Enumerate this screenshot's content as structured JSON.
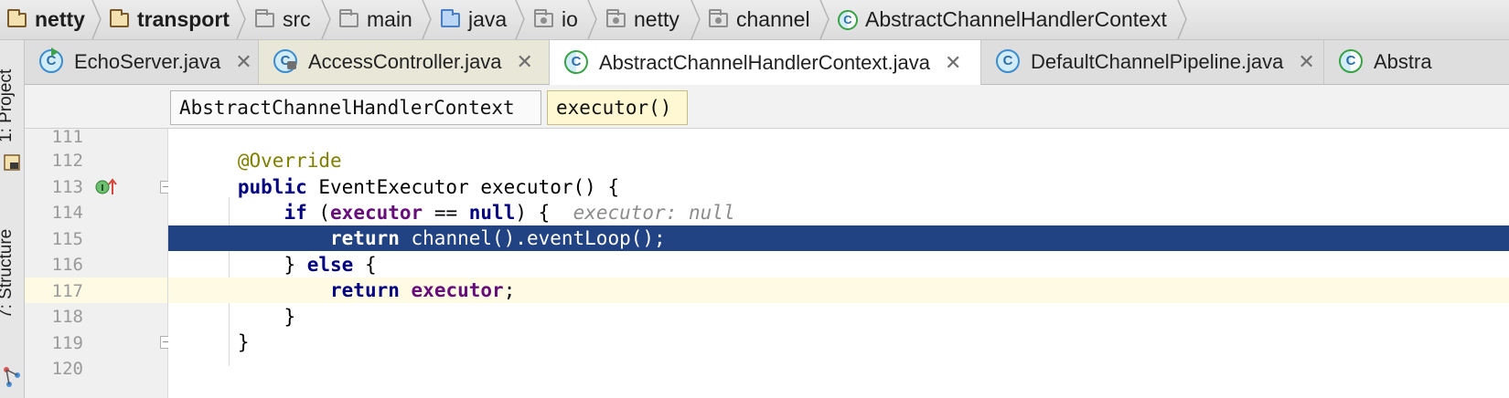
{
  "breadcrumbs": [
    {
      "label": "netty",
      "icon": "module-folder-icon",
      "bold": true
    },
    {
      "label": "transport",
      "icon": "module-folder-icon",
      "bold": true
    },
    {
      "label": "src",
      "icon": "folder-icon",
      "bold": false
    },
    {
      "label": "main",
      "icon": "folder-icon",
      "bold": false
    },
    {
      "label": "java",
      "icon": "source-folder-icon",
      "bold": false
    },
    {
      "label": "io",
      "icon": "package-icon",
      "bold": false
    },
    {
      "label": "netty",
      "icon": "package-icon",
      "bold": false
    },
    {
      "label": "channel",
      "icon": "package-icon",
      "bold": false
    },
    {
      "label": "AbstractChannelHandlerContext",
      "icon": "abstract-class-icon",
      "bold": false
    }
  ],
  "tool_windows": {
    "project": "1: Project",
    "structure": "7: Structure"
  },
  "tabs": [
    {
      "label": "EchoServer.java",
      "close": "✕",
      "icon": "runnable-class-icon"
    },
    {
      "label": "AccessController.java",
      "close": "✕",
      "icon": "locked-class-icon"
    },
    {
      "label": "AbstractChannelHandlerContext.java",
      "close": "✕",
      "icon": "abstract-class-icon",
      "active": true
    },
    {
      "label": "DefaultChannelPipeline.java",
      "close": "✕",
      "icon": "class-icon"
    },
    {
      "label": "Abstra",
      "icon": "abstract-class-icon"
    }
  ],
  "class_icon_letter": "C",
  "structure_path": {
    "class": "AbstractChannelHandlerContext",
    "method": "executor()"
  },
  "line_numbers": [
    "111",
    "112",
    "113",
    "114",
    "115",
    "116",
    "117",
    "118",
    "119",
    "120"
  ],
  "code": {
    "l112_ann": "@Override",
    "l113_kw": "public",
    "l113_rest": " EventExecutor executor() {",
    "l114_kw": "if",
    "l114_open": " (",
    "l114_fld": "executor",
    "l114_op": " == ",
    "l114_null": "null",
    "l114_close": ") {",
    "l114_hint": "executor: null",
    "l115_kw": "return",
    "l115_rest": " channel().eventLoop();",
    "l116_a": "} ",
    "l116_kw": "else",
    "l116_b": " {",
    "l117_kw": "return",
    "l117_fld": "executor",
    "l117_end": ";",
    "l118": "}",
    "l119": "}"
  },
  "colors": {
    "selection": "#214283",
    "caret_row": "#fffae3",
    "keyword": "#000080",
    "annotation": "#808000",
    "field": "#660e7a"
  }
}
